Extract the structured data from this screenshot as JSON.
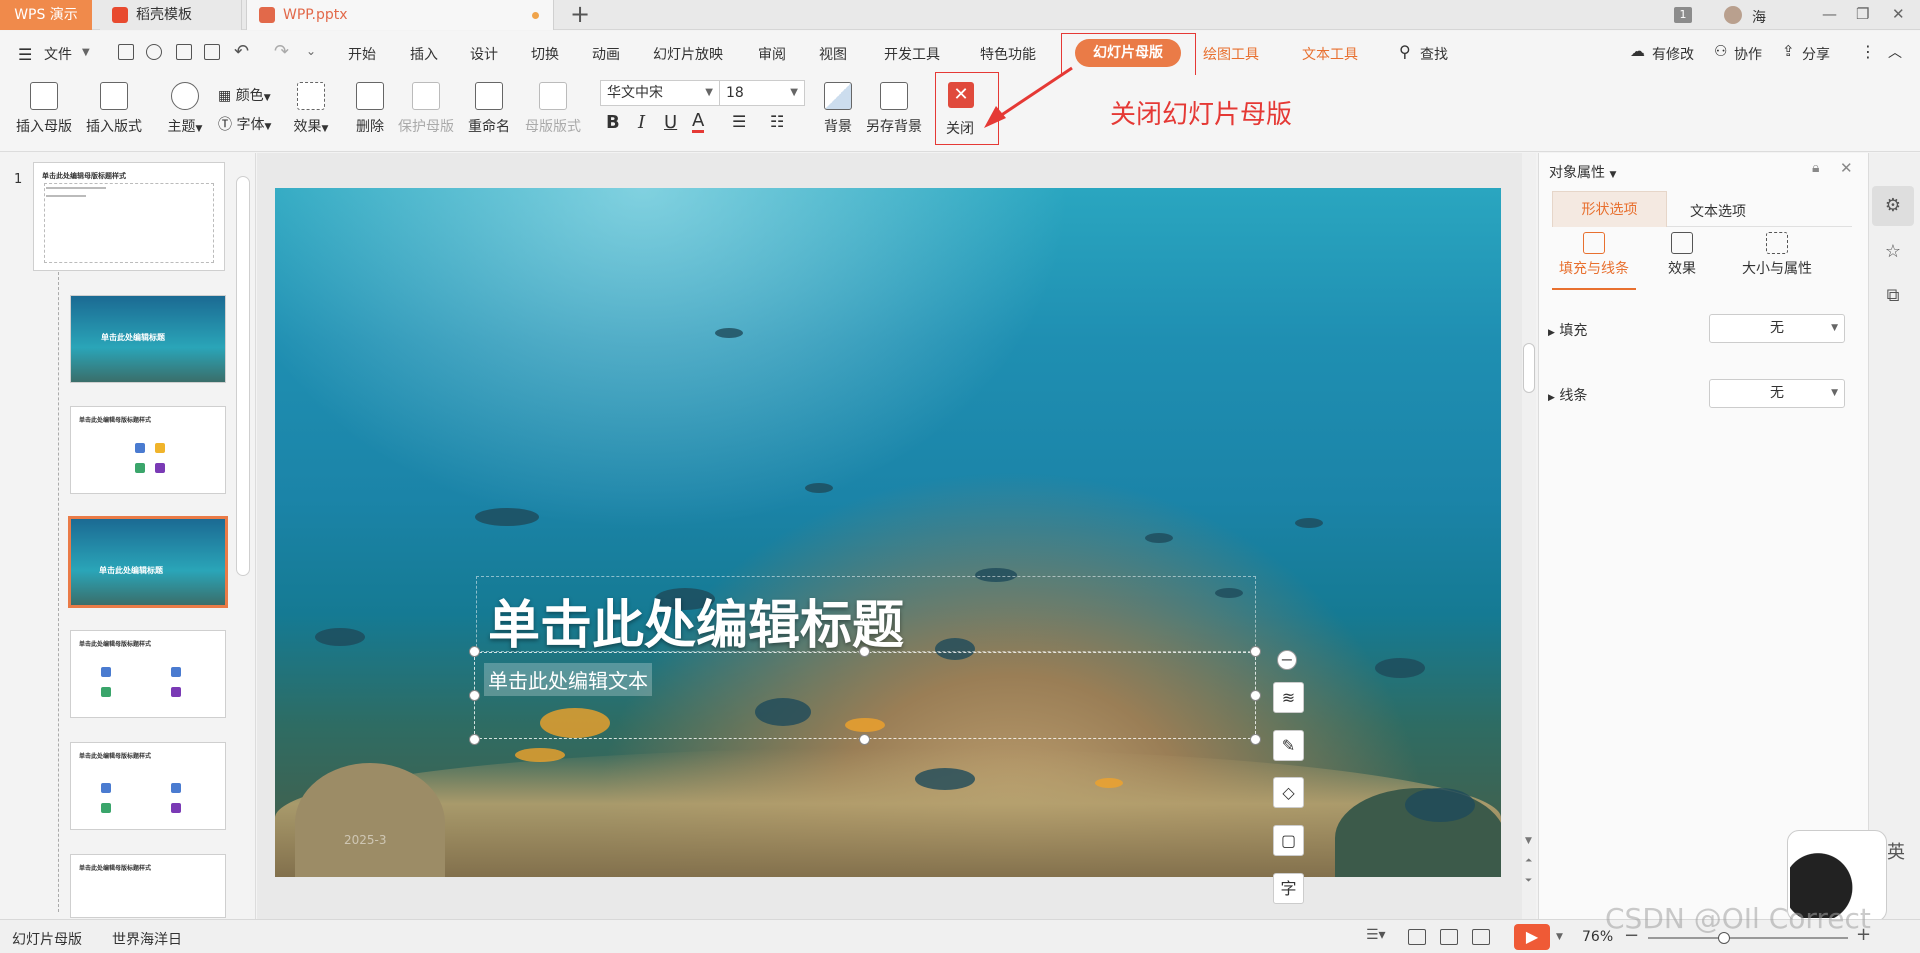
{
  "titlebar": {
    "app_tab": "WPS 演示",
    "tabs": [
      {
        "label": "稻壳模板"
      },
      {
        "label": "WPP.pptx"
      }
    ],
    "new_tab": "+",
    "page_badge": "1",
    "user_name": "海"
  },
  "menubar": {
    "file": "文件",
    "items": [
      "开始",
      "插入",
      "设计",
      "切换",
      "动画",
      "幻灯片放映",
      "审阅",
      "视图",
      "开发工具",
      "特色功能"
    ],
    "active_tab": "幻灯片母版",
    "context_tabs": [
      "绘图工具",
      "文本工具"
    ],
    "search": "查找",
    "right": [
      "有修改",
      "协作",
      "分享"
    ]
  },
  "ribbon": {
    "insert_master": "插入母版",
    "insert_layout": "插入版式",
    "theme": "主题",
    "colors": "颜色",
    "font": "字体",
    "effects": "效果",
    "bg_fill": "背景",
    "delete": "删除",
    "protect_master": "保护母版",
    "rename": "重命名",
    "master_layout": "母版版式",
    "font_name": "华文中宋",
    "font_size": "18",
    "background": "背景",
    "save_background": "另存背景",
    "close": "关闭"
  },
  "annotation": {
    "text": "关闭幻灯片母版",
    "color": "#e53935"
  },
  "slide_pane": {
    "first_index": "1",
    "thumbs": [
      {
        "title": "单击此处编辑母版标题样式"
      },
      {
        "title": "单击此处编辑标题"
      },
      {
        "title": "单击此处编辑母版标题样式"
      },
      {
        "title": "单击此处编辑标题"
      },
      {
        "title": "单击此处编辑母版标题样式"
      },
      {
        "title": "单击此处编辑母版标题样式"
      },
      {
        "title": "单击此处编辑母版标题样式"
      }
    ],
    "selected_index": 3
  },
  "slide": {
    "title": "单击此处编辑标题",
    "body": "单击此处编辑文本",
    "date": "2025-3"
  },
  "float_tools": [
    "−",
    "layers-icon",
    "brush-icon",
    "fill-icon",
    "border-icon",
    "字"
  ],
  "properties": {
    "header": "对象属性",
    "tabs": [
      "形状选项",
      "文本选项"
    ],
    "subtabs": [
      "填充与线条",
      "效果",
      "大小与属性"
    ],
    "fill_label": "填充",
    "fill_value": "无",
    "line_label": "线条",
    "line_value": "无"
  },
  "ime": {
    "label": "英"
  },
  "statusbar": {
    "mode": "幻灯片母版",
    "theme": "世界海洋日",
    "zoom": "76%",
    "zoom_fraction": 0.38
  },
  "watermark": "CSDN @OIl Correct",
  "colors": {
    "accent": "#ea7b47",
    "wps_tab": "#f08a4b",
    "play": "#ef5a36"
  }
}
